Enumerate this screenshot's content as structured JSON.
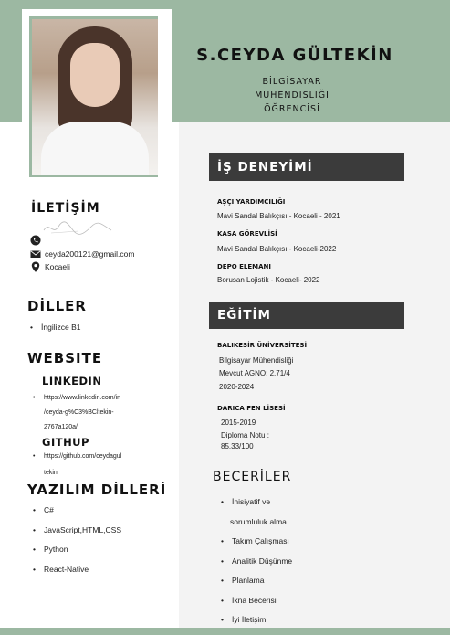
{
  "header": {
    "name": "S.CEYDA GÜLTEKİN",
    "subtitle_lines": [
      "BİLGİSAYAR",
      "MÜHENDİSLİĞİ",
      "ÖĞRENCİSİ"
    ]
  },
  "contact": {
    "title": "İLETİŞİM",
    "phone": "",
    "email": "ceyda200121@gmail.com",
    "location": "Kocaeli"
  },
  "languages": {
    "title": "DİLLER",
    "items": [
      "İngilizce B1"
    ]
  },
  "website": {
    "title": "WEBSITE",
    "linkedin_label": "LINKEDIN",
    "linkedin_lines": [
      "https://www.linkedin.com/in",
      "/ceyda-g%C3%BCltekin-",
      "2767a120a/"
    ],
    "github_label": "GITHUP",
    "github_lines": [
      "https://github.com/ceydagul",
      "tekin"
    ]
  },
  "programming": {
    "title": "YAZILIM DİLLERİ",
    "items": [
      "C#",
      "JavaScript,HTML,CSS",
      "Python",
      "React-Native"
    ]
  },
  "experience": {
    "title": "İŞ DENEYİMİ",
    "jobs": [
      {
        "title": "AŞÇI YARDIMCILIĞI",
        "detail": "Mavi Sandal Balıkçısı - Kocaeli - 2021"
      },
      {
        "title": "KASA GÖREVLİSİ",
        "detail": "Mavi Sandal Balıkçısı - Kocaeli-2022"
      },
      {
        "title": "DEPO ELEMANI",
        "detail": "Borusan Lojistik - Kocaeli- 2022"
      }
    ]
  },
  "education": {
    "title": "EĞİTİM",
    "schools": [
      {
        "name": "BALIKESİR ÜNİVERSİTESİ",
        "lines": [
          "Bilgisayar Mühendisliği",
          "Mevcut AGNO: 2.71/4",
          "2020-2024"
        ]
      },
      {
        "name": "DARICA FEN LİSESİ",
        "lines": [
          "2015-2019",
          "Diploma Notu :",
          "85.33/100"
        ]
      }
    ]
  },
  "skills": {
    "title": "BECERİLER",
    "items": [
      "İnisiyatif ve",
      "sorumluluk alma.",
      "Takım Çalışması",
      "Analitik Düşünme",
      "Planlama",
      "İkna Becerisi",
      "İyi İletişim"
    ]
  },
  "colors": {
    "accent_green": "#9cb8a2",
    "dark_bar": "#3b3b3b"
  }
}
